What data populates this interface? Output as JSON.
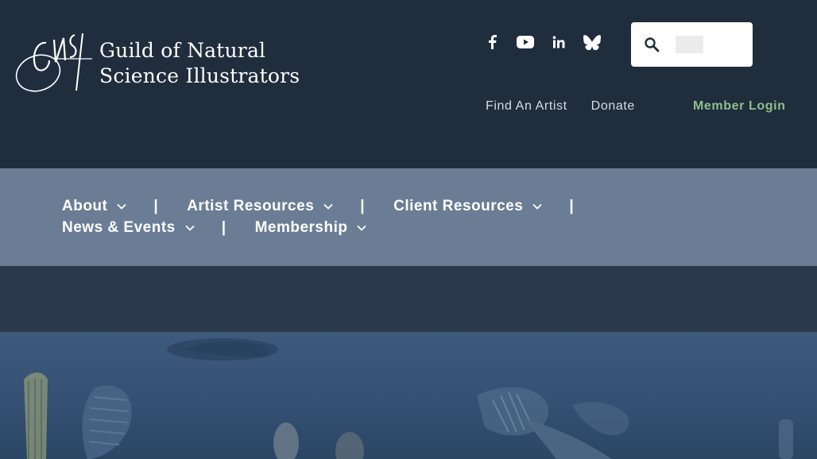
{
  "logo": {
    "monogram": "GNSI",
    "line1": "Guild of Natural",
    "line2": "Science Illustrators"
  },
  "social": [
    {
      "icon": "facebook-icon"
    },
    {
      "icon": "youtube-icon"
    },
    {
      "icon": "linkedin-icon"
    },
    {
      "icon": "bluesky-icon"
    }
  ],
  "search": {
    "value": "",
    "placeholder": ""
  },
  "utility": {
    "find_artist": "Find An Artist",
    "donate": "Donate",
    "member_login": "Member Login"
  },
  "nav": {
    "separator": "|",
    "items": [
      {
        "label": "About"
      },
      {
        "label": "Artist Resources"
      },
      {
        "label": "Client Resources"
      },
      {
        "label": "News & Events"
      },
      {
        "label": "Membership"
      }
    ]
  },
  "colors": {
    "header_bg": "#1f2d3d",
    "nav_bg": "#6b7d95",
    "member_login": "#8fbf8a",
    "hero_bg": "#3d5a7c"
  }
}
